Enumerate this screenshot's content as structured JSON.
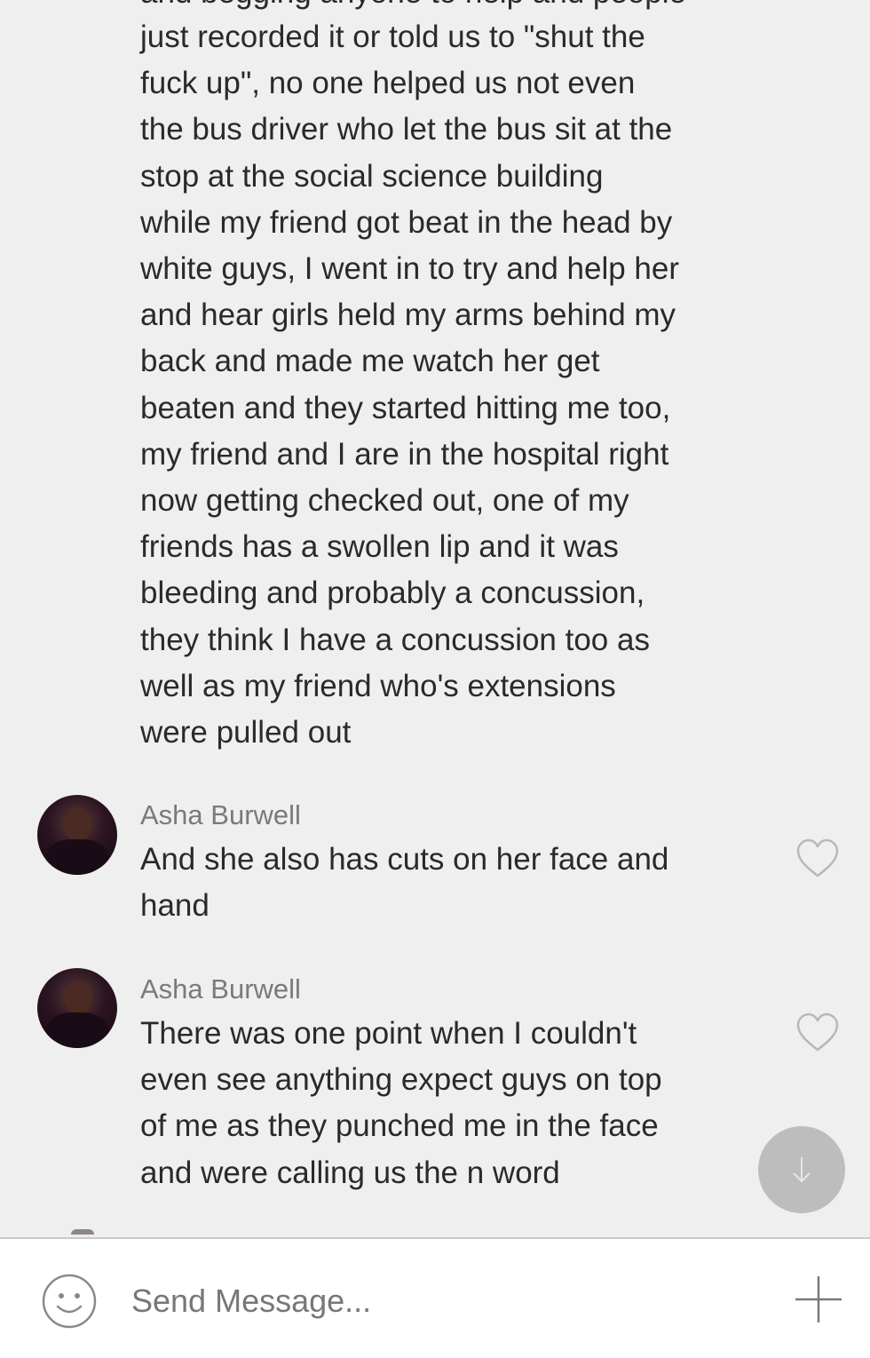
{
  "chat": {
    "cutoff_line": "and begging anyone to help and people",
    "continued_message": "just recorded it or told us to \"shut the\nfuck up\", no one helped us not even\nthe bus driver who let the bus sit at the\nstop at the social science building\nwhile my friend got beat in the head by\nwhite guys, I went in to try and help her\nand hear girls held my arms behind my\nback and made me watch her get\nbeaten and they started hitting me too,\nmy friend and I are in the hospital right\nnow getting checked out, one of my\nfriends  has a swollen lip and it was\nbleeding and probably a concussion,\nthey think I have a concussion too as\nwell as my friend who's extensions\nwere pulled out",
    "messages": [
      {
        "author": "Asha Burwell",
        "text": "And she also has cuts on her face and\nhand",
        "like_icon": "heart-outline-icon"
      },
      {
        "author": "Asha Burwell",
        "text": "There was one point when I couldn't\neven see anything expect guys on top\nof me as they punched me in the face\nand were calling us the n word",
        "like_icon": "heart-outline-icon"
      }
    ],
    "scroll_button_icon": "arrow-down-icon"
  },
  "composer": {
    "placeholder": "Send Message...",
    "emoji_icon": "smiley-icon",
    "add_icon": "plus-icon"
  },
  "colors": {
    "background": "#efefef",
    "footer": "#ffffff",
    "text": "#2a2a2a",
    "author": "#7a7a7a",
    "scroll_button": "#bdbdbd"
  }
}
